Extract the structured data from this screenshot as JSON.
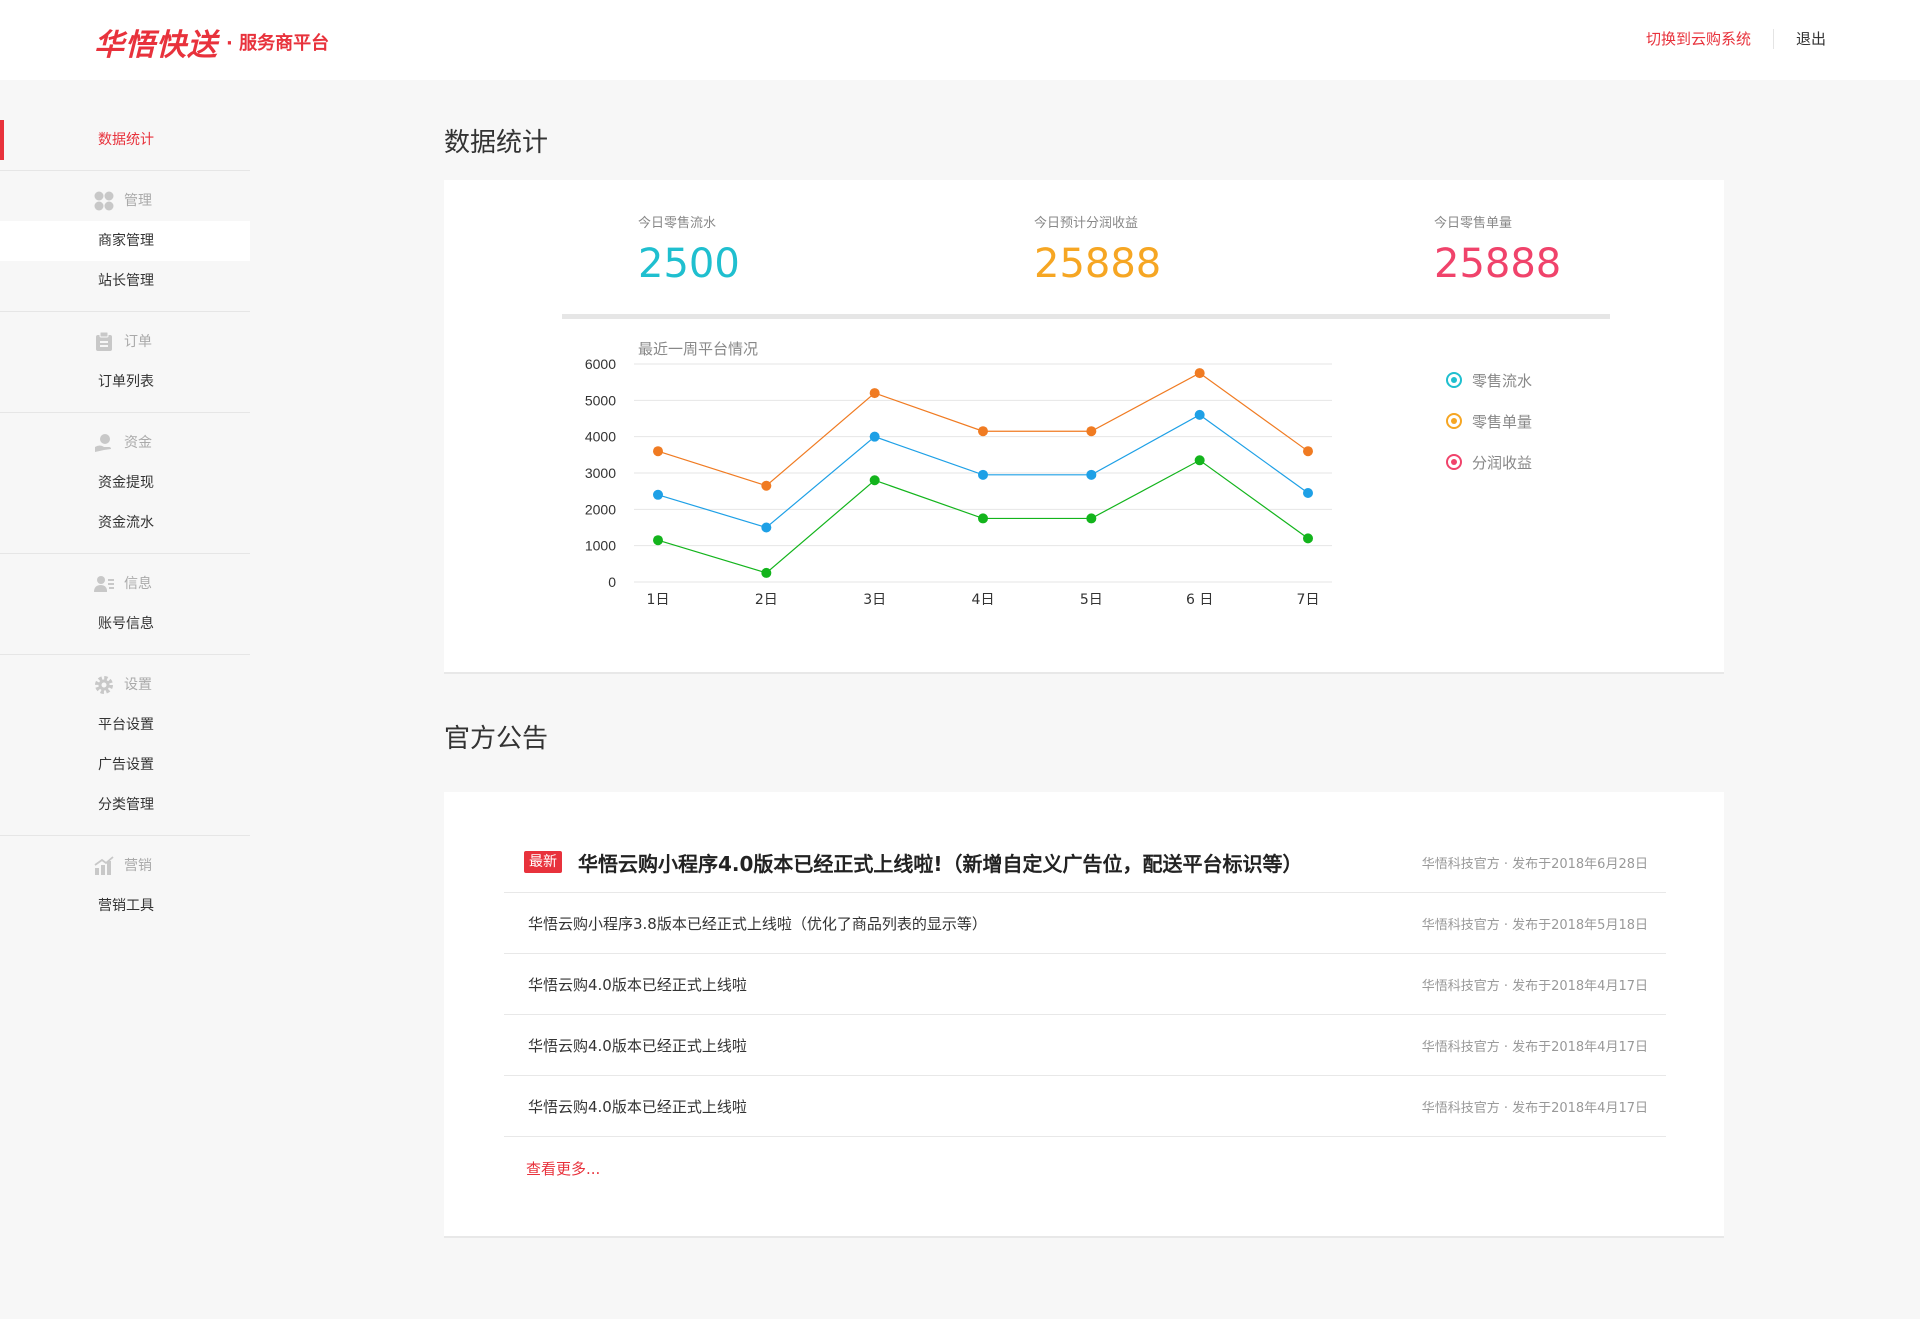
{
  "header": {
    "logo_main": "华悟快送",
    "logo_sub": "· 服务商平台",
    "switch_label": "切换到云购系统",
    "logout_label": "退出"
  },
  "sidebar": {
    "stats_label": "数据统计",
    "groups": {
      "manage": {
        "label": "管理",
        "icon": "grid-icon",
        "items": [
          "商家管理",
          "站长管理"
        ]
      },
      "order": {
        "label": "订单",
        "icon": "clipboard-icon",
        "items": [
          "订单列表"
        ]
      },
      "fund": {
        "label": "资金",
        "icon": "hand-coin-icon",
        "items": [
          "资金提现",
          "资金流水"
        ]
      },
      "info": {
        "label": "信息",
        "icon": "user-card-icon",
        "items": [
          "账号信息"
        ]
      },
      "settings": {
        "label": "设置",
        "icon": "gear-icon",
        "items": [
          "平台设置",
          "广告设置",
          "分类管理"
        ]
      },
      "marketing": {
        "label": "营销",
        "icon": "bar-chart-icon",
        "items": [
          "营销工具"
        ]
      }
    }
  },
  "stats_section": {
    "title": "数据统计",
    "stats": [
      {
        "label": "今日零售流水",
        "value": "2500",
        "color": "#1fbfcf"
      },
      {
        "label": "今日预计分润收益",
        "value": "25888",
        "color": "#f6a623"
      },
      {
        "label": "今日零售单量",
        "value": "25888",
        "color": "#f0436b"
      }
    ],
    "chart_subtitle": "最近一周平台情况"
  },
  "legend": [
    {
      "label": "零售流水",
      "color": "#1fbfcf"
    },
    {
      "label": "零售单量",
      "color": "#f6a623"
    },
    {
      "label": "分润收益",
      "color": "#f0436b"
    }
  ],
  "chart_data": {
    "type": "line",
    "title": "最近一周平台情况",
    "categories": [
      "1日",
      "2日",
      "3日",
      "4日",
      "5日",
      "6 日",
      "7日"
    ],
    "yticks": [
      "0",
      "1000",
      "2000",
      "3000",
      "4000",
      "5000",
      "6000"
    ],
    "ylim": [
      0,
      6000
    ],
    "grid": true,
    "legend_placement": "right",
    "series": [
      {
        "color": "#f07b22",
        "values": [
          3600,
          2650,
          5200,
          4150,
          4150,
          5750,
          3600
        ]
      },
      {
        "color": "#1ea0e6",
        "values": [
          2400,
          1500,
          4000,
          2950,
          2950,
          4600,
          2450
        ]
      },
      {
        "color": "#13b41c",
        "values": [
          1150,
          250,
          2800,
          1750,
          1750,
          3350,
          1200
        ]
      }
    ]
  },
  "notice_section": {
    "title": "官方公告",
    "badge": "最新",
    "items": [
      {
        "title": "华悟云购小程序4.0版本已经正式上线啦!（新增自定义广告位，配送平台标识等）",
        "meta": "华悟科技官方 · 发布于2018年6月28日"
      },
      {
        "title": "华悟云购小程序3.8版本已经正式上线啦（优化了商品列表的显示等）",
        "meta": "华悟科技官方 · 发布于2018年5月18日"
      },
      {
        "title": "华悟云购4.0版本已经正式上线啦",
        "meta": "华悟科技官方 · 发布于2018年4月17日"
      },
      {
        "title": "华悟云购4.0版本已经正式上线啦",
        "meta": "华悟科技官方 · 发布于2018年4月17日"
      },
      {
        "title": "华悟云购4.0版本已经正式上线啦",
        "meta": "华悟科技官方 · 发布于2018年4月17日"
      }
    ],
    "more_label": "查看更多..."
  }
}
